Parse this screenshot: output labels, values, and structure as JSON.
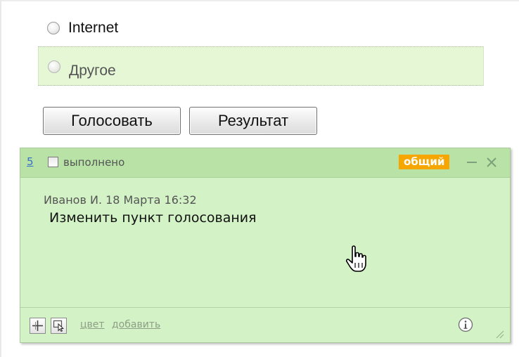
{
  "poll": {
    "options": [
      {
        "label": "Internet"
      },
      {
        "label": "Другое"
      }
    ],
    "vote_button": "Голосовать",
    "result_button": "Результат"
  },
  "note": {
    "number": "5",
    "done_label": "выполнено",
    "done_checked": false,
    "badge": "общий",
    "badge_color": "#f7a600",
    "background_color": "#d3f2c6",
    "header_color": "#b8e2a6",
    "author_line": "Иванов И. 18 Марта 16:32",
    "text": "Изменить пункт голосования",
    "footer": {
      "color_link": "цвет",
      "add_link": "добавить"
    },
    "icons": [
      "minimize-icon",
      "close-icon",
      "move-icon",
      "select-icon",
      "info-icon",
      "resize-grip-icon",
      "hand-cursor-icon"
    ]
  }
}
